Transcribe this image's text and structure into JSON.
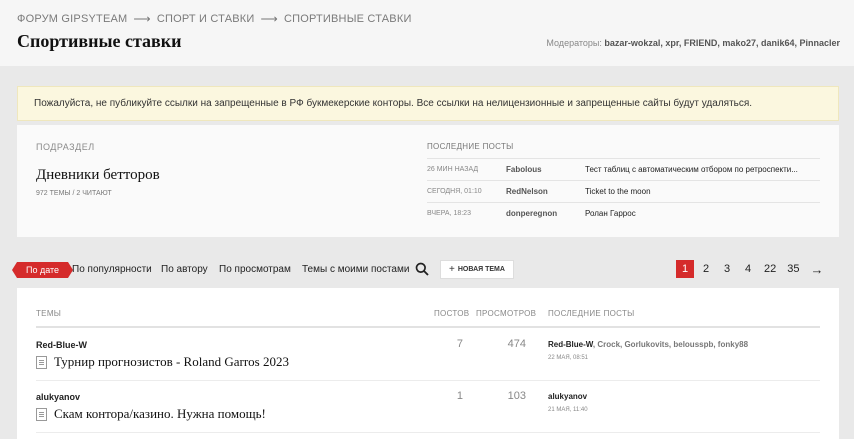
{
  "breadcrumb": {
    "items": [
      "ФОРУМ GIPSYTEAM",
      "СПОРТ И СТАВКИ",
      "СПОРТИВНЫЕ СТАВКИ"
    ],
    "separator": "⟶"
  },
  "page": {
    "title": "Спортивные ставки"
  },
  "moderators": {
    "label": "Модераторы:",
    "names": "bazar-wokzal, xpr, FRIEND, mako27, danik64, Pinnacler"
  },
  "notice": {
    "text": "Пожалуйста, не публикуйте ссылки на запрещенные в РФ букмекерские конторы. Все ссылки на нелицензионные и запрещенные сайты будут удаляться."
  },
  "subforum": {
    "header": "ПОДРАЗДЕЛ",
    "name": "Дневники бетторов",
    "meta": "972 ТЕМЫ / 2 ЧИТАЮТ",
    "last_posts_header": "ПОСЛЕДНИЕ ПОСТЫ",
    "last_posts": [
      {
        "time": "26 МИН НАЗАД",
        "author": "Fabolous",
        "title": "Тест таблиц с автоматическим отбором по ретроспекти..."
      },
      {
        "time": "СЕГОДНЯ, 01:10",
        "author": "RedNelson",
        "title": "Ticket to the moon"
      },
      {
        "time": "ВЧЕРА, 18:23",
        "author": "donperegnon",
        "title": "Ролан Гаррос"
      }
    ]
  },
  "sort": {
    "active": "По дате",
    "options": [
      "По популярности",
      "По автору",
      "По просмотрам",
      "Темы с моими постами"
    ]
  },
  "new_topic": {
    "label": "НОВАЯ ТЕМА",
    "icon": "plus-icon"
  },
  "pagination": {
    "pages": [
      "1",
      "2",
      "3",
      "4",
      "22",
      "35"
    ],
    "current": "1",
    "next": "→"
  },
  "topics": {
    "headers": {
      "topics": "ТЕМЫ",
      "posts": "ПОСТОВ",
      "views": "ПРОСМОТРОВ",
      "last_posts": "ПОСЛЕДНИЕ ПОСТЫ"
    },
    "rows": [
      {
        "author": "Red-Blue-W",
        "title": "Турнир прогнозистов - Roland Garros 2023",
        "posts": "7",
        "views": "474",
        "lp_author": "Red-Blue-W",
        "lp_others": ", Crock, Gorlukovits, belousspb, fonky88",
        "lp_date": "22 МАЯ, 08:51"
      },
      {
        "author": "alukyanov",
        "title": "Скам контора/казино. Нужна помощь!",
        "posts": "1",
        "views": "103",
        "lp_author": "alukyanov",
        "lp_others": "",
        "lp_date": "21 МАЯ, 11:40"
      }
    ]
  },
  "colors": {
    "accent": "#d52b2b",
    "notice_bg": "#fbf7df",
    "page_bg": "#e9e9e9"
  }
}
